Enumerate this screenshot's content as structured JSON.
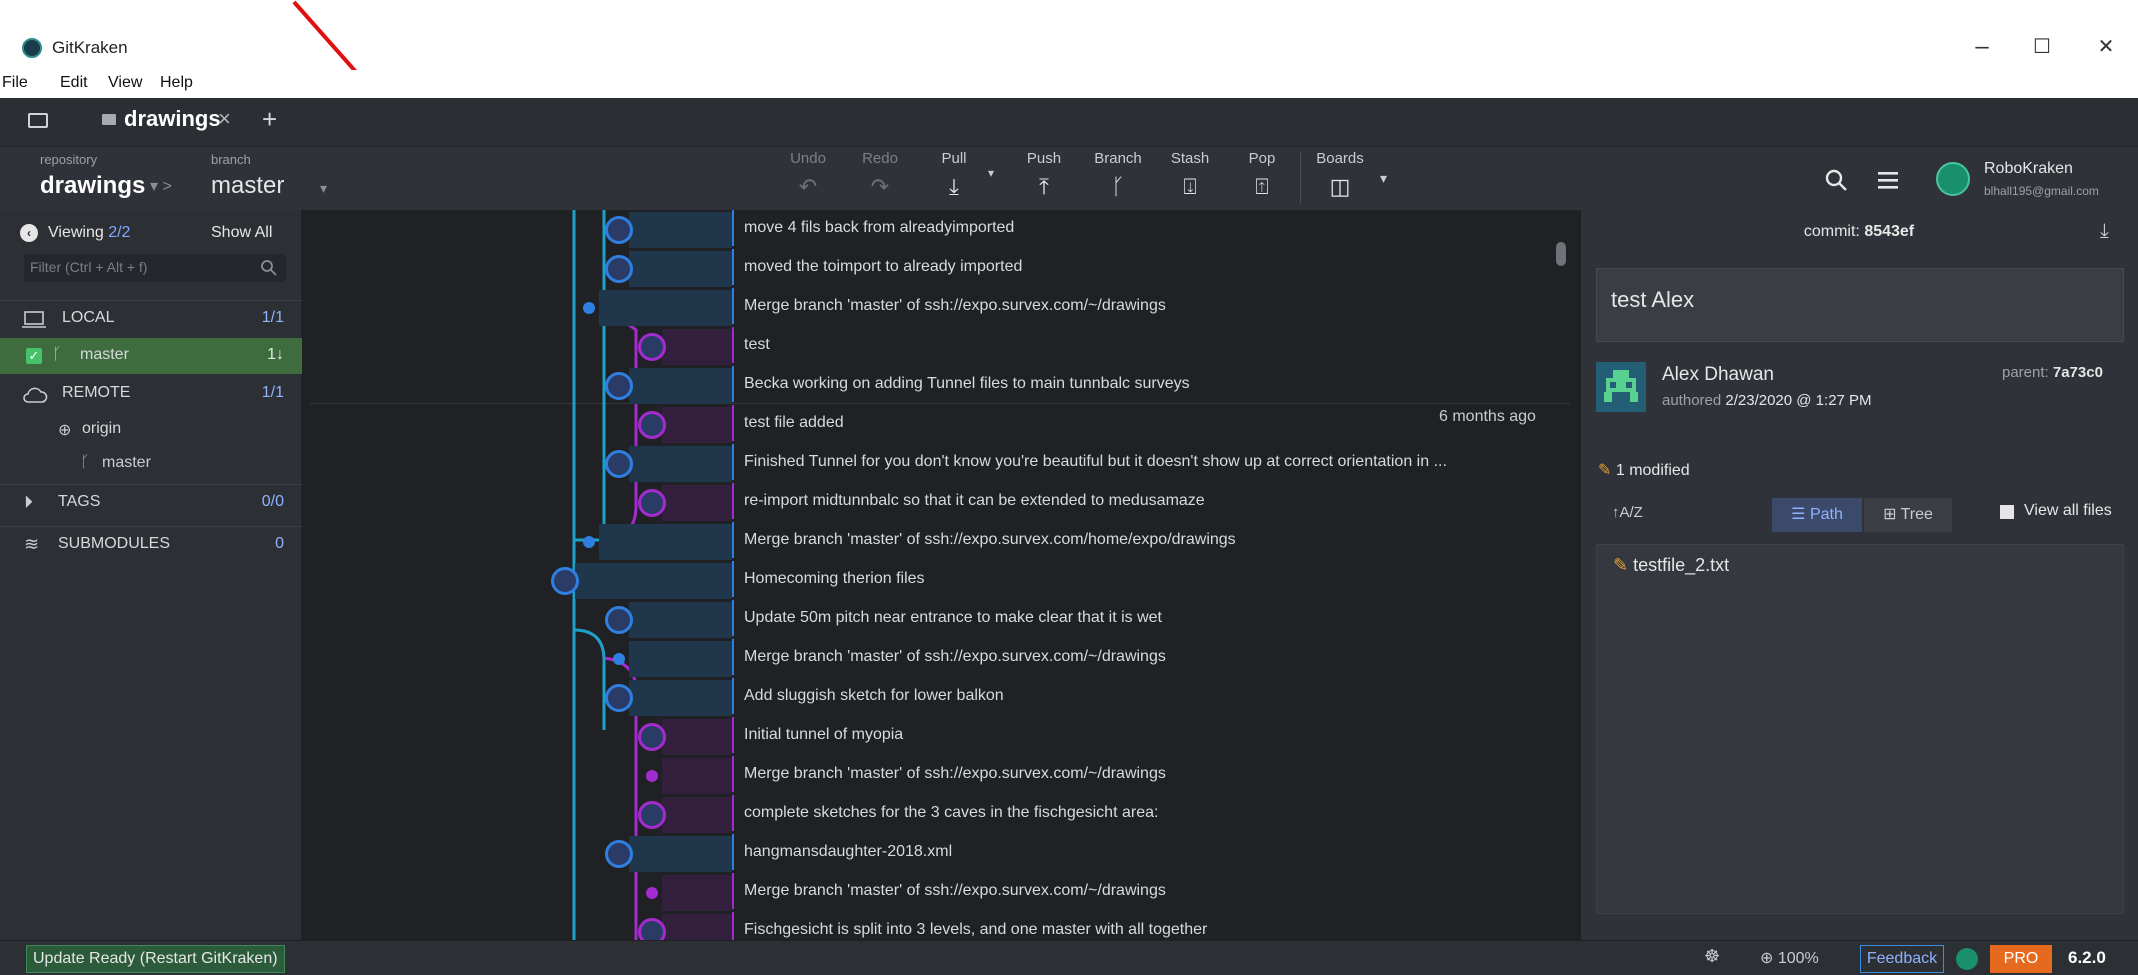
{
  "window": {
    "title": "GitKraken",
    "controls": {
      "minimize": "–",
      "maximize": "☐",
      "close": "✕"
    }
  },
  "menu": [
    "File",
    "Edit",
    "View",
    "Help"
  ],
  "tabs": {
    "folder_icon": "folder-icon",
    "active_tab": "drawings",
    "close": "×",
    "add": "+"
  },
  "toolbar": {
    "repository_label": "repository",
    "repository": "drawings",
    "branch_label": "branch",
    "branch": "master",
    "actions": [
      {
        "label": "Undo",
        "icon": "↶"
      },
      {
        "label": "Redo",
        "icon": "↷"
      },
      {
        "label": "Pull",
        "icon": "⤓"
      },
      {
        "label": "Push",
        "icon": "⤒"
      },
      {
        "label": "Branch",
        "icon": "ᚴ"
      },
      {
        "label": "Stash",
        "icon": "⍗"
      },
      {
        "label": "Pop",
        "icon": "⍐"
      },
      {
        "label": "Boards",
        "icon": "◫"
      }
    ],
    "user_name": "RoboKraken",
    "user_email": "blhall195@gmail.com"
  },
  "left_panel": {
    "viewing_label": "Viewing",
    "viewing_value": "2/2",
    "show_all": "Show All",
    "filter_placeholder": "Filter (Ctrl + Alt + f)",
    "sections": [
      {
        "name": "LOCAL",
        "count": "1/1"
      },
      {
        "name": "REMOTE",
        "count": "1/1"
      },
      {
        "name": "TAGS",
        "count": "0/0"
      },
      {
        "name": "SUBMODULES",
        "count": "0"
      }
    ],
    "local_branch": {
      "name": "master",
      "status": "1↓"
    },
    "remote": {
      "name": "origin",
      "branch": "master"
    }
  },
  "commits": [
    "move 4 fils back from alreadyimported",
    "moved the toimport to already imported",
    "Merge branch 'master' of ssh://expo.survex.com/~/drawings",
    "test",
    "Becka working on adding Tunnel files to main tunnbalc surveys",
    "test file added",
    "Finished Tunnel for you don't know you're beautiful but it doesn't show up at correct orientation in ...",
    "re-import midtunnbalc so that it can be extended to medusamaze",
    "Merge branch 'master' of ssh://expo.survex.com/home/expo/drawings",
    "Homecoming therion files",
    "Update 50m pitch near entrance to make clear that it is wet",
    "Merge branch 'master' of ssh://expo.survex.com/~/drawings",
    "Add sluggish sketch for lower balkon",
    "Initial tunnel of myopia",
    "Merge branch 'master' of ssh://expo.survex.com/~/drawings",
    "complete sketches for the 3 caves in the fischgesicht area:",
    "hangmansdaughter-2018.xml",
    "Merge branch 'master' of ssh://expo.survex.com/~/drawings",
    "Fischgesicht is split into 3 levels, and one master with all together"
  ],
  "hover_time": "6 months ago",
  "detail": {
    "commit_label": "commit:",
    "commit_hash": "8543ef",
    "message": "test Alex",
    "author": "Alex Dhawan",
    "authored_label": "authored",
    "authored_date": "2/23/2020 @ 1:27 PM",
    "parent_label": "parent:",
    "parent_hash": "7a73c0",
    "modified": "1 modified",
    "path_btn": "Path",
    "tree_btn": "Tree",
    "view_all": "View all files",
    "sort_icon": "↑A/Z",
    "files": [
      "testfile_2.txt"
    ]
  },
  "status": {
    "update": "Update Ready (Restart GitKraken)",
    "zoom": "100%",
    "feedback": "Feedback",
    "pro": "PRO",
    "version": "6.2.0"
  },
  "colors": {
    "accent_blue": "#3b8dde",
    "graph_cyan": "#1fa0c8",
    "graph_purple": "#a32bd0",
    "annotation_red": "#e01010",
    "pro_orange": "#e56a1f"
  }
}
